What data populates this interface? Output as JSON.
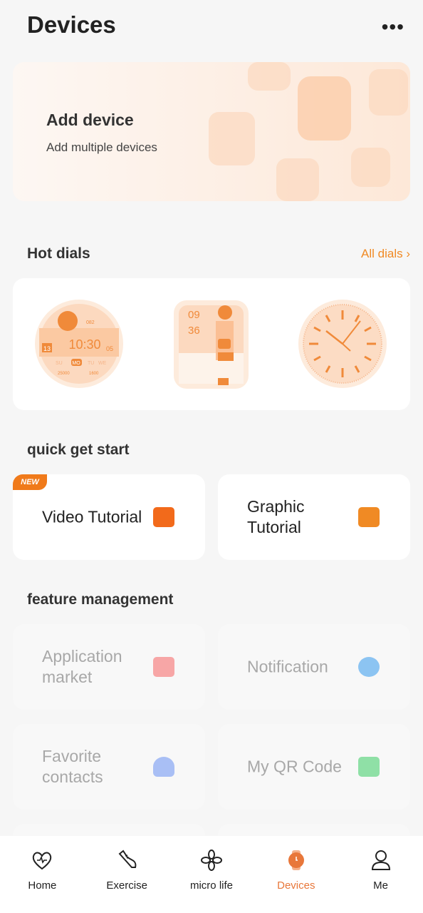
{
  "header": {
    "title": "Devices",
    "more_icon": "more-horizontal-icon"
  },
  "banner": {
    "title": "Add device",
    "subtitle": "Add multiple devices"
  },
  "hot_dials": {
    "title": "Hot dials",
    "all_label": "All dials",
    "dials": [
      {
        "name": "digital-round",
        "time": "10:30",
        "date": "13",
        "days": [
          "SU",
          "MO",
          "TU",
          "WE"
        ],
        "heart": "082",
        "steps": "25000",
        "cal": "1600",
        "month": "05"
      },
      {
        "name": "character-square",
        "hour": "09",
        "minute": "36"
      },
      {
        "name": "analog-round"
      }
    ]
  },
  "quick_start": {
    "title": "quick get start",
    "badge": "NEW",
    "items": [
      {
        "label": "Video Tutorial",
        "icon": "video-icon",
        "color": "#f26a1b"
      },
      {
        "label": "Graphic Tutorial",
        "icon": "image-icon",
        "color": "#f08a24"
      }
    ]
  },
  "feature_management": {
    "title": "feature management",
    "items": [
      {
        "label": "Application market",
        "icon": "shopping-bag-icon",
        "color": "#f7a6a6"
      },
      {
        "label": "Notification",
        "icon": "chat-bubble-icon",
        "color": "#8cc4f2"
      },
      {
        "label": "Favorite contacts",
        "icon": "contacts-icon",
        "color": "#a9bff5"
      },
      {
        "label": "My QR Code",
        "icon": "qr-card-icon",
        "color": "#8fe0a6"
      }
    ]
  },
  "nav": {
    "active_color": "#e8773a",
    "items": [
      {
        "label": "Home",
        "icon": "heart-pulse-icon"
      },
      {
        "label": "Exercise",
        "icon": "shoe-icon"
      },
      {
        "label": "micro life",
        "icon": "clover-icon"
      },
      {
        "label": "Devices",
        "icon": "watch-icon",
        "active": true
      },
      {
        "label": "Me",
        "icon": "person-icon"
      }
    ]
  }
}
